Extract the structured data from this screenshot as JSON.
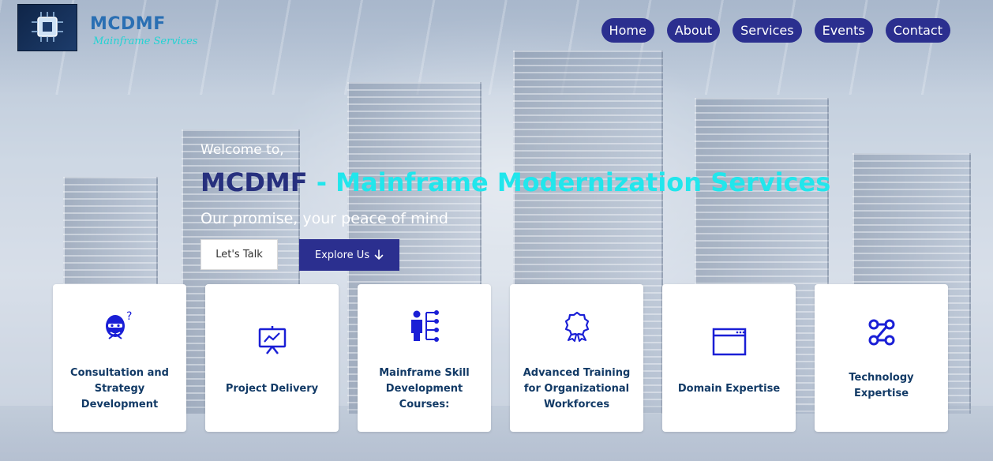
{
  "header": {
    "brand_title": "MCDMF",
    "brand_subtitle": "Mainframe Services",
    "nav": [
      {
        "label": "Home"
      },
      {
        "label": "About"
      },
      {
        "label": "Services"
      },
      {
        "label": "Events"
      },
      {
        "label": "Contact"
      }
    ]
  },
  "hero": {
    "welcome": "Welcome to,",
    "title_brand": "MCDMF",
    "title_rest": " - Mainframe Modernization Services",
    "tagline": "Our promise, your peace of mind",
    "primary_button": "Let's Talk",
    "secondary_button": "Explore Us"
  },
  "cards": [
    {
      "label": "Consultation and Strategy Development",
      "icon": "consultation-icon"
    },
    {
      "label": "Project Delivery",
      "icon": "presentation-chart-icon"
    },
    {
      "label": "Mainframe Skill Development Courses:",
      "icon": "skill-tree-icon"
    },
    {
      "label": "Advanced Training for Organizational Workforces",
      "icon": "award-ribbon-icon"
    },
    {
      "label": "Domain Expertise",
      "icon": "browser-window-icon"
    },
    {
      "label": "Technology Expertise",
      "icon": "workflow-icon"
    }
  ],
  "colors": {
    "nav_bg": "#2b2f8f",
    "brand_dark": "#27307e",
    "brand_cyan": "#21e6ec",
    "card_text": "#123a66",
    "icon_blue": "#1a1fd6"
  }
}
